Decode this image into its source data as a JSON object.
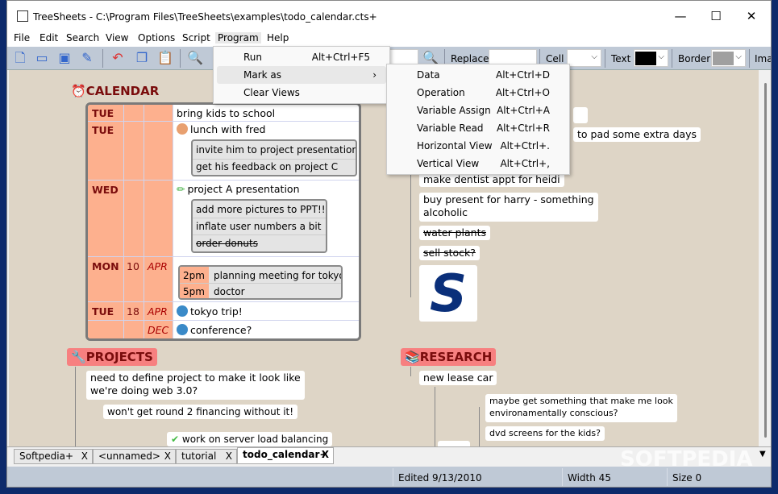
{
  "window": {
    "title": "TreeSheets - C:\\Program Files\\TreeSheets\\examples\\todo_calendar.cts+",
    "minimize": "—",
    "maximize": "☐",
    "close": "✕"
  },
  "menubar": [
    "File",
    "Edit",
    "Search",
    "View",
    "Options",
    "Script",
    "Program",
    "Help"
  ],
  "toolbar": {
    "replace_label": "Replace",
    "cell_label": "Cell",
    "text_label": "Text",
    "border_label": "Border",
    "image_label": "Ima",
    "text_color": "#000000",
    "border_color": "#a0a0a0",
    "search_value": "",
    "replace_value": ""
  },
  "program_menu": [
    {
      "label": "Run",
      "shortcut": "Alt+Ctrl+F5"
    },
    {
      "label": "Mark as",
      "shortcut": "›"
    },
    {
      "label": "Clear Views",
      "shortcut": ""
    }
  ],
  "mark_as_menu": [
    {
      "label": "Data",
      "shortcut": "Alt+Ctrl+D"
    },
    {
      "label": "Operation",
      "shortcut": "Alt+Ctrl+O"
    },
    {
      "label": "Variable Assign",
      "shortcut": "Alt+Ctrl+A"
    },
    {
      "label": "Variable Read",
      "shortcut": "Alt+Ctrl+R"
    },
    {
      "label": "Horizontal View",
      "shortcut": "Alt+Ctrl+."
    },
    {
      "label": "Vertical View",
      "shortcut": "Alt+Ctrl+,"
    }
  ],
  "calendar": {
    "title": "CALENDAR",
    "rows": [
      {
        "day": "TUE",
        "num": "",
        "month": "",
        "text": "bring kids to school"
      },
      {
        "day": "TUE",
        "num": "",
        "month": "",
        "text": "lunch with fred",
        "sub": [
          "invite him to project presentation",
          "get his feedback on project C"
        ]
      },
      {
        "day": "WED",
        "num": "",
        "month": "",
        "text": "project A presentation",
        "sub": [
          "add more pictures to PPT!!",
          "inflate user numbers a bit",
          "order donuts"
        ]
      },
      {
        "day": "MON",
        "num": "10",
        "month": "APR",
        "times": [
          {
            "t": "2pm",
            "e": "planning meeting for tokyo"
          },
          {
            "t": "5pm",
            "e": "doctor"
          }
        ]
      },
      {
        "day": "TUE",
        "num": "18",
        "month": "APR",
        "text": "tokyo trip!"
      },
      {
        "day": "",
        "num": "",
        "month": "DEC",
        "text": "conference?"
      }
    ]
  },
  "todo": {
    "items": [
      "to pad some extra days",
      "make dentist appt for heidi",
      "buy present for harry - something",
      "alcoholic",
      "water plants",
      "sell stock?"
    ],
    "logo_letter": "S"
  },
  "projects": {
    "title": "PROJECTS",
    "items": [
      "need to define project to make it look like",
      "we're doing web 3.0?",
      "won't get round 2 financing without it!",
      "work on server load balancing"
    ]
  },
  "research": {
    "title": "RESEARCH",
    "items": [
      "new lease car",
      "maybe get something that make me look",
      "environamentally conscious?",
      "dvd screens for the kids?"
    ]
  },
  "tabs": [
    {
      "label": "Softpedia+",
      "active": false
    },
    {
      "label": "<unnamed>",
      "active": false
    },
    {
      "label": "tutorial",
      "active": false
    },
    {
      "label": "todo_calendar+",
      "active": true
    }
  ],
  "tab_close": "X",
  "status": {
    "edited": "Edited 9/13/2010",
    "width": "Width 45",
    "size": "Size 0"
  },
  "watermark": "SOFTPEDIA",
  "colors": {
    "canvas": "#ded5c6",
    "header_pink": "#f78080",
    "calendar_date": "#fdb08e",
    "header_text": "#7a0c0c"
  }
}
